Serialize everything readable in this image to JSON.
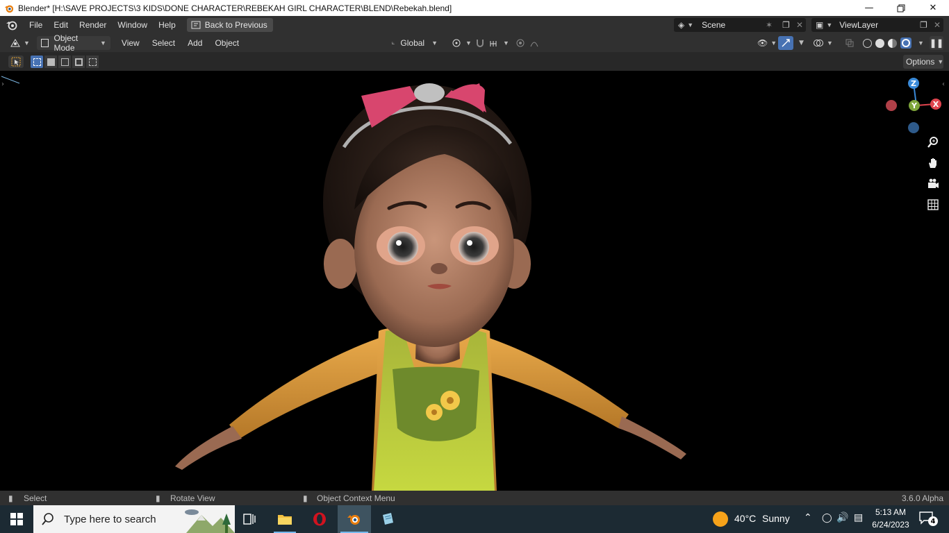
{
  "window": {
    "title": "Blender* [H:\\SAVE PROJECTS\\3 KIDS\\DONE CHARACTER\\REBEKAH GIRL CHARACTER\\BLEND\\Rebekah.blend]",
    "minimize_icon": "minimize-icon",
    "maximize_icon": "restore-icon",
    "close_icon": "close-icon"
  },
  "menubar": {
    "items": [
      "File",
      "Edit",
      "Render",
      "Window",
      "Help"
    ],
    "back_button": "Back to Previous",
    "scene_label": "Scene",
    "view_layer_label": "ViewLayer"
  },
  "viewport_header": {
    "mode": "Object Mode",
    "menus": [
      "View",
      "Select",
      "Add",
      "Object"
    ],
    "transform_orientation": "Global",
    "options_label": "Options"
  },
  "gizmo": {
    "axis_z": "Z",
    "axis_y": "Y",
    "axis_x": "X",
    "colors": {
      "x": "#e0444e",
      "y": "#7ea53b",
      "z": "#3a8ad8"
    }
  },
  "statusbar": {
    "select": "Select",
    "rotate": "Rotate View",
    "context_menu": "Object Context Menu",
    "version": "3.6.0 Alpha"
  },
  "taskbar": {
    "search_placeholder": "Type here to search",
    "weather_temp": "40°C",
    "weather_desc": "Sunny",
    "time": "5:13 AM",
    "date": "6/24/2023",
    "notification_count": "4"
  },
  "colors": {
    "ui_bg": "#303030",
    "viewport_bg": "#000000",
    "accent_blue": "#4772b3"
  }
}
